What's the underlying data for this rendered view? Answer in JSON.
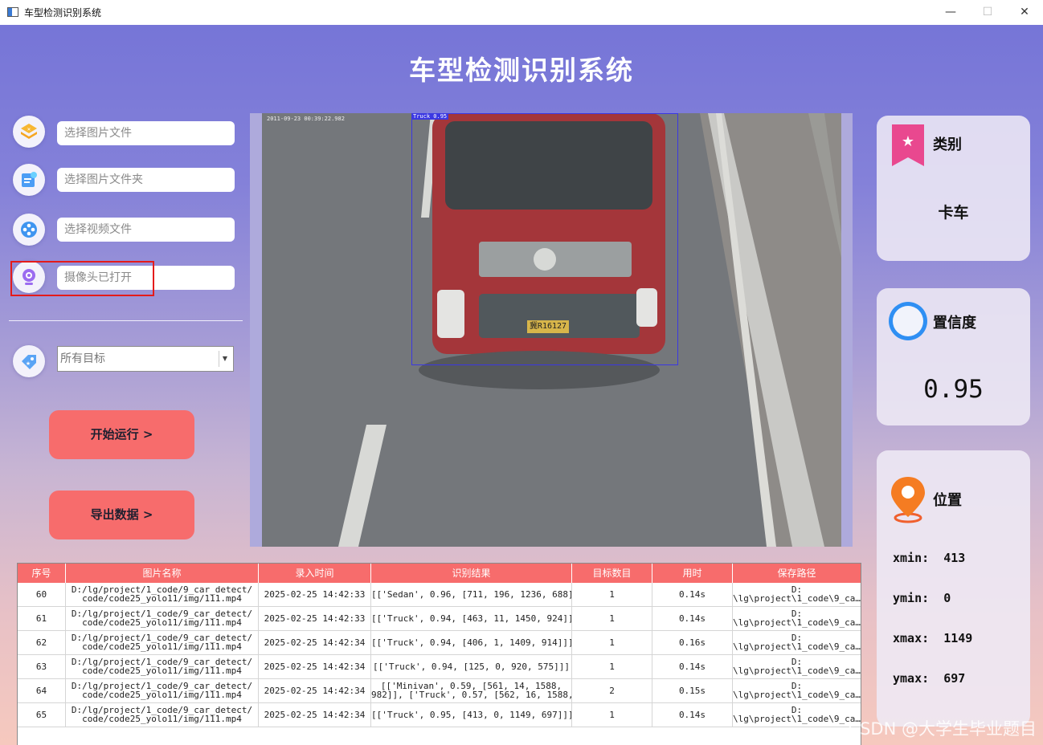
{
  "window": {
    "title": "车型检测识别系统",
    "minimize": "—",
    "maximize": "☐",
    "close": "✕"
  },
  "app_title": "车型检测识别系统",
  "left_panel": {
    "image_file_placeholder": "选择图片文件",
    "image_folder_placeholder": "选择图片文件夹",
    "video_file_placeholder": "选择视频文件",
    "camera_status": "摄像头已打开",
    "target_select": "所有目标",
    "start_button": "开始运行 >",
    "export_button": "导出数据 >"
  },
  "video": {
    "timestamp": "2011-09-23 00:39:22.982",
    "box_label": "Truck 0.95",
    "plate": "冀R16127"
  },
  "cards": {
    "class_title": "类别",
    "class_value": "卡车",
    "confidence_title": "置信度",
    "confidence_value": "0.95",
    "position_title": "位置",
    "xmin_label": "xmin:",
    "xmin": "413",
    "ymin_label": "ymin:",
    "ymin": "0",
    "xmax_label": "xmax:",
    "xmax": "1149",
    "ymax_label": "ymax:",
    "ymax": "697"
  },
  "table": {
    "headers": [
      "序号",
      "图片名称",
      "录入时间",
      "识别结果",
      "目标数目",
      "用时",
      "保存路径"
    ],
    "rows": [
      {
        "id": "60",
        "name1": "D:/lg/project/1_code/9_car_detect/",
        "name2": "code/code25_yolo11/img/111.mp4",
        "time": "2025-02-25 14:42:33",
        "result": "[['Sedan', 0.96, [711, 196, 1236, 688]]]",
        "result2": "",
        "count": "1",
        "elapsed": "0.14s",
        "path1": "D:",
        "path2": "\\lg\\project\\1_code\\9_ca…"
      },
      {
        "id": "61",
        "name1": "D:/lg/project/1_code/9_car_detect/",
        "name2": "code/code25_yolo11/img/111.mp4",
        "time": "2025-02-25 14:42:33",
        "result": "[['Truck', 0.94, [463, 11, 1450, 924]]]",
        "result2": "",
        "count": "1",
        "elapsed": "0.14s",
        "path1": "D:",
        "path2": "\\lg\\project\\1_code\\9_ca…"
      },
      {
        "id": "62",
        "name1": "D:/lg/project/1_code/9_car_detect/",
        "name2": "code/code25_yolo11/img/111.mp4",
        "time": "2025-02-25 14:42:34",
        "result": "[['Truck', 0.94, [406, 1, 1409, 914]]]",
        "result2": "",
        "count": "1",
        "elapsed": "0.16s",
        "path1": "D:",
        "path2": "\\lg\\project\\1_code\\9_ca…"
      },
      {
        "id": "63",
        "name1": "D:/lg/project/1_code/9_car_detect/",
        "name2": "code/code25_yolo11/img/111.mp4",
        "time": "2025-02-25 14:42:34",
        "result": "[['Truck', 0.94, [125, 0, 920, 575]]]",
        "result2": "",
        "count": "1",
        "elapsed": "0.14s",
        "path1": "D:",
        "path2": "\\lg\\project\\1_code\\9_ca…"
      },
      {
        "id": "64",
        "name1": "D:/lg/project/1_code/9_car_detect/",
        "name2": "code/code25_yolo11/img/111.mp4",
        "time": "2025-02-25 14:42:34",
        "result": "[['Minivan', 0.59, [561, 14, 1588,",
        "result2": "982]], ['Truck', 0.57, [562, 16, 1588,…",
        "count": "2",
        "elapsed": "0.15s",
        "path1": "D:",
        "path2": "\\lg\\project\\1_code\\9_ca…"
      },
      {
        "id": "65",
        "name1": "D:/lg/project/1_code/9_car_detect/",
        "name2": "code/code25_yolo11/img/111.mp4",
        "time": "2025-02-25 14:42:34",
        "result": "[['Truck', 0.95, [413, 0, 1149, 697]]]",
        "result2": "",
        "count": "1",
        "elapsed": "0.14s",
        "path1": "D:",
        "path2": "\\lg\\project\\1_code\\9_ca…"
      }
    ]
  },
  "watermark": "CSDN @大学生毕业题目"
}
